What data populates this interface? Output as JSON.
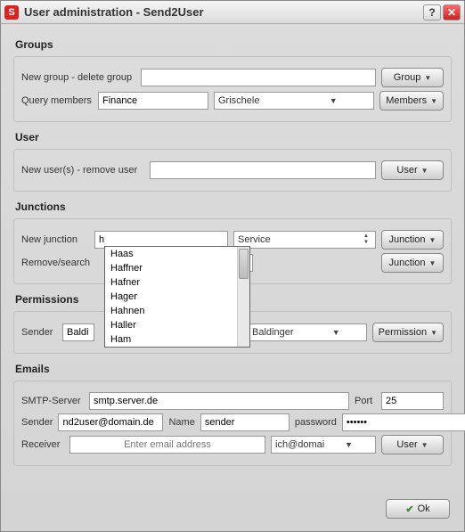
{
  "title": "User administration - Send2User",
  "icon_letter": "S",
  "groups": {
    "title": "Groups",
    "new_group_label": "New group - delete group",
    "new_group_value": "",
    "group_btn": "Group",
    "query_label": "Query members",
    "query_value": "Finance",
    "query_member": "Grischele",
    "members_btn": "Members"
  },
  "user": {
    "title": "User",
    "label": "New user(s) - remove user",
    "value": "",
    "btn": "User"
  },
  "junctions": {
    "title": "Junctions",
    "new_label": "New junction",
    "new_value": "h",
    "service": "Service",
    "junction_btn": "Junction",
    "remove_label": "Remove/search",
    "remove_value": "",
    "options": [
      "Haas",
      "Haffner",
      "Hafner",
      "Hager",
      "Hahnen",
      "Haller",
      "Ham"
    ]
  },
  "permissions": {
    "title": "Permissions",
    "sender_label": "Sender",
    "sender_value": "Baldi",
    "combo": "Baldinger",
    "permission_btn": "Permission"
  },
  "emails": {
    "title": "Emails",
    "smtp_label": "SMTP-Server",
    "smtp_value": "smtp.server.de",
    "port_label": "Port",
    "port_value": "25",
    "sender_label": "Sender",
    "sender_value": "nd2user@domain.de",
    "name_label": "Name",
    "name_value": "sender",
    "password_label": "password",
    "password_value": "••••••",
    "receiver_label": "Receiver",
    "receiver_placeholder": "Enter email address",
    "receiver_value": "",
    "receiver_combo": "ich@domain.de",
    "user_btn": "User"
  },
  "ok": "Ok"
}
